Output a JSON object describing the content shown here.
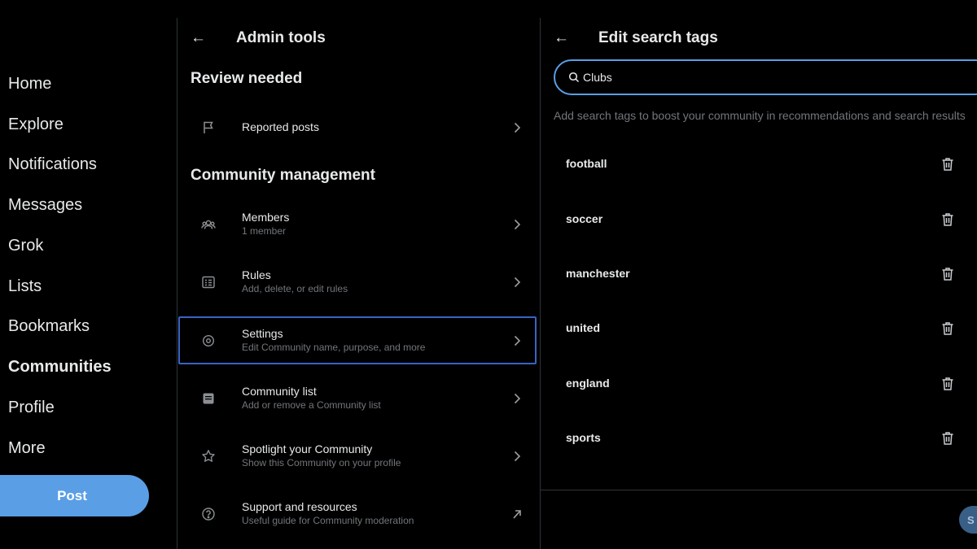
{
  "nav": {
    "items": [
      {
        "label": "Home"
      },
      {
        "label": "Explore"
      },
      {
        "label": "Notifications"
      },
      {
        "label": "Messages"
      },
      {
        "label": "Grok"
      },
      {
        "label": "Lists"
      },
      {
        "label": "Bookmarks"
      },
      {
        "label": "Communities"
      },
      {
        "label": "Profile"
      },
      {
        "label": "More"
      }
    ],
    "active": "Communities",
    "post_label": "Post"
  },
  "admin": {
    "title": "Admin tools",
    "back_glyph": "←",
    "review_section": "Review needed",
    "management_section": "Community management",
    "rows": [
      {
        "icon": "flag-icon",
        "title": "Reported posts",
        "subtitle": "",
        "action": "chevron-right-icon"
      },
      {
        "icon": "members-icon",
        "title": "Members",
        "subtitle": "1 member",
        "action": "chevron-right-icon"
      },
      {
        "icon": "rules-icon",
        "title": "Rules",
        "subtitle": "Add, delete, or edit rules",
        "action": "chevron-right-icon"
      },
      {
        "icon": "settings-icon",
        "title": "Settings",
        "subtitle": "Edit Community name, purpose, and more",
        "action": "chevron-right-icon",
        "selected": true
      },
      {
        "icon": "community-list-icon",
        "title": "Community list",
        "subtitle": "Add or remove a Community list",
        "action": "chevron-right-icon"
      },
      {
        "icon": "star-icon",
        "title": "Spotlight your Community",
        "subtitle": "Show this Community on your profile",
        "action": "chevron-right-icon"
      },
      {
        "icon": "help-icon",
        "title": "Support and resources",
        "subtitle": "Useful guide for Community moderation",
        "action": "external-link-icon"
      }
    ]
  },
  "tags": {
    "title": "Edit search tags",
    "back_glyph": "←",
    "search": {
      "value": "Clubs",
      "placeholder": ""
    },
    "hint": "Add search tags to boost your community in recommendations and search results",
    "items": [
      "football",
      "soccer",
      "manchester",
      "united",
      "england",
      "sports"
    ],
    "save_label": "S"
  },
  "colors": {
    "accent": "#1d9bf0",
    "background": "#000000",
    "selection_border": "#3a63c4",
    "post_button": "#5a9ee6"
  }
}
